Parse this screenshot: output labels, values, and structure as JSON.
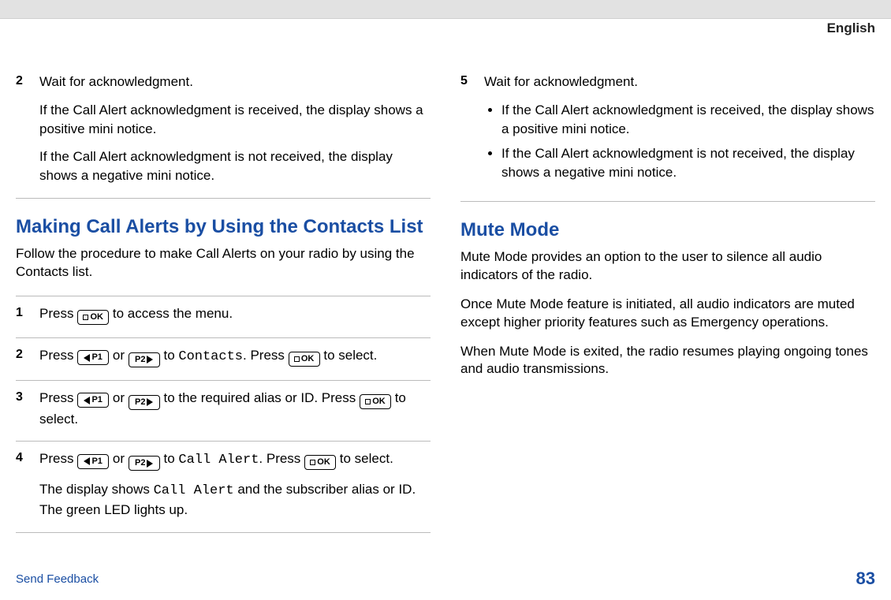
{
  "header": {
    "language": "English"
  },
  "icons": {
    "p1": "P1",
    "p2": "P2",
    "ok": "OK"
  },
  "left": {
    "pre_step": {
      "num": "2",
      "para1": "Wait for acknowledgment.",
      "para2": "If the Call Alert acknowledgment is received, the display shows a positive mini notice.",
      "para3": "If the Call Alert acknowledgment is not received, the display shows a negative mini notice."
    },
    "section_heading": "Making Call Alerts by Using the Contacts List",
    "section_intro": "Follow the procedure to make Call Alerts on your radio by using the Contacts list.",
    "steps": {
      "s1": {
        "num": "1",
        "a": "Press ",
        "b": " to access the menu."
      },
      "s2": {
        "num": "2",
        "a": "Press ",
        "b": " or ",
        "c": " to ",
        "menu": "Contacts",
        "d": ". Press ",
        "e": " to select."
      },
      "s3": {
        "num": "3",
        "a": "Press ",
        "b": " or ",
        "c": " to the required alias or ID. Press ",
        "d": " to select."
      }
    }
  },
  "right": {
    "steps": {
      "s4": {
        "num": "4",
        "a": "Press ",
        "b": " or ",
        "c": " to ",
        "menu": "Call Alert",
        "d": ". Press ",
        "e": " to select.",
        "para2a": "The display shows ",
        "para2menu": "Call Alert",
        "para2b": " and the subscriber alias or ID. The green LED lights up."
      },
      "s5": {
        "num": "5",
        "para1": "Wait for acknowledgment.",
        "b1": "If the Call Alert acknowledgment is received, the display shows a positive mini notice.",
        "b2": "If the Call Alert acknowledgment is not received, the display shows a negative mini notice."
      }
    },
    "section2_heading": "Mute Mode",
    "section2_p1": "Mute Mode provides an option to the user to silence all audio indicators of the radio.",
    "section2_p2": "Once Mute Mode feature is initiated, all audio indicators are muted except higher priority features such as Emergency operations.",
    "section2_p3": "When Mute Mode is exited, the radio resumes playing ongoing tones and audio transmissions."
  },
  "footer": {
    "feedback": "Send Feedback",
    "page": "83"
  }
}
